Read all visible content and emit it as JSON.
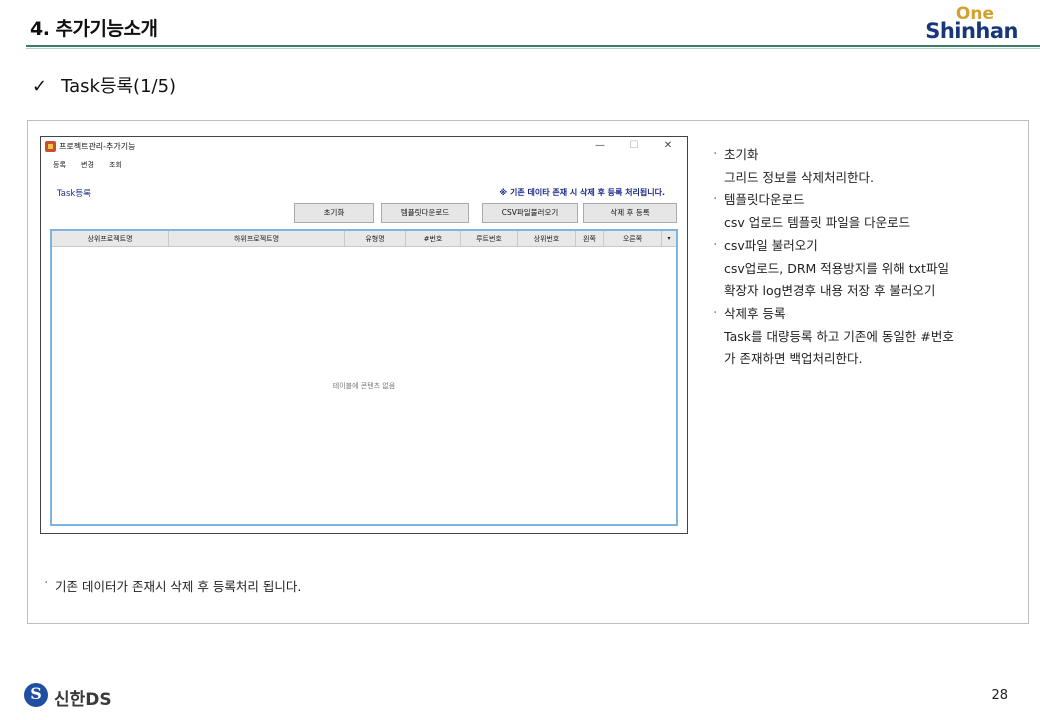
{
  "header": {
    "title": "4. 추가기능소개",
    "logo_top": "One",
    "logo_bottom": "Shinhan"
  },
  "subtitle": {
    "check": "✓",
    "text": "Task등록(1/5)"
  },
  "window": {
    "title": "프로젝트관리-추가기능",
    "controls": {
      "minimize": "—",
      "maximize": "☐",
      "close": "✕"
    },
    "menu": [
      "등록",
      "변경",
      "조회"
    ],
    "task_label": "Task등록",
    "notice": "※ 기존 데이타 존재 시 삭제 후 등록 처리됩니다.",
    "buttons": [
      "초기화",
      "템플릿다운로드",
      "CSV파일불러오기",
      "삭제 후 등록"
    ],
    "grid": {
      "columns": [
        "상위프로젝트명",
        "하위프로젝트명",
        "유형명",
        "#번호",
        "루트번호",
        "상위번호",
        "왼쪽",
        "오른쪽"
      ],
      "empty_text": "테이블에 콘텐츠 없음"
    }
  },
  "notes": [
    {
      "bullet": "초기화",
      "desc": [
        "그리드 정보를 삭제처리한다."
      ]
    },
    {
      "bullet": "템플릿다운로드",
      "desc": [
        "csv 업로드 템플릿 파일을 다운로드"
      ]
    },
    {
      "bullet": "csv파일 불러오기",
      "desc": [
        "csv업로드, DRM 적용방지를 위해 txt파일",
        "확장자 log변경후 내용 저장 후 불러오기"
      ]
    },
    {
      "bullet": "삭제후 등록",
      "desc": [
        "Task를 대량등록 하고 기존에 동일한 #번호",
        "가 존재하면 백업처리한다."
      ]
    }
  ],
  "bottom_note": "기존 데이터가 존재시 삭제 후 등록처리 됩니다.",
  "footer": {
    "company": "신한DS",
    "page_number": "28"
  },
  "colors": {
    "accent_rule": "#3c7a6a",
    "logo_gold": "#d2a230",
    "logo_navy": "#17377a",
    "notice_blue": "#1a2a8a",
    "grid_border": "#7fb4e0"
  }
}
